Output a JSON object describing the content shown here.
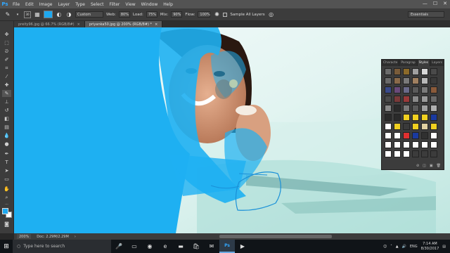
{
  "app": {
    "logo": "Ps"
  },
  "menu": [
    "File",
    "Edit",
    "Image",
    "Layer",
    "Type",
    "Select",
    "Filter",
    "View",
    "Window",
    "Help"
  ],
  "window_controls": [
    "—",
    "☐",
    "✕"
  ],
  "options": {
    "brush_size": "30",
    "mode_value": "Custom",
    "web_label": "Web:",
    "web_value": "80%",
    "load_label": "Load:",
    "load_value": "75%",
    "mix_label": "Mix:",
    "mix_value": "90%",
    "flow_label": "Flow:",
    "flow_value": "100%",
    "sample_all_layers": "Sample All Layers",
    "workspace": "Essentials",
    "brush_color": "#1ea8ef"
  },
  "tabs": [
    {
      "label": "preity96.jpg @ 66.7% (RGB/8#)",
      "close": "×",
      "active": false
    },
    {
      "label": "priyanka50.jpg @ 200% (RGB/8#) *",
      "close": "×",
      "active": true
    }
  ],
  "styles_panel": {
    "tabs": [
      "Characte",
      "Paragrap",
      "Styles",
      "Layers"
    ],
    "active_tab": "Styles",
    "footer_icons": [
      "⊘",
      "◫",
      "▣",
      "🗑"
    ],
    "swatches": [
      "#6b6b6b",
      "#7a5c3a",
      "#8c6a2a",
      "#a0a0a0",
      "#d8d8d8",
      "#4a4a4a",
      "#6a6a6a",
      "#8a6a4a",
      "#7a7a7a",
      "#a08060",
      "#b8b8b8",
      "#3a3a3a",
      "#3a4a8a",
      "#6a4a7a",
      "#6a6a8a",
      "#5a5a5a",
      "#7a7a7a",
      "#8a5a3a",
      "#4a4a4a",
      "#7a3a3a",
      "#9a3a3a",
      "#8a8a8a",
      "#9a9a9a",
      "#6a6a6a",
      "#8a8a8a",
      "#2a2a2a",
      "#7a7a7a",
      "#5a5a5a",
      "#a0a0a0",
      "#b0b0b0",
      "#2a2a2a",
      "#2a2a2a",
      "#f0d020",
      "#f0d020",
      "#f0d020",
      "#1a3aa0",
      "#ffffff",
      "#f0d020",
      "#3a3a3a",
      "#f0d020",
      "#e0d0a0",
      "#f0d020",
      "#ffffff",
      "#ffffff",
      "#e03030",
      "#1a3aa0",
      "#303030",
      "#ffffff",
      "#ffffff",
      "#ffffff",
      "#ffffff",
      "#ffffff",
      "#ffffff",
      "#ffffff",
      "#ffffff",
      "#ffffff",
      "#ffffff",
      "#3c3c3c",
      "#3c3c3c",
      "#3c3c3c"
    ]
  },
  "status": {
    "zoom": "200%",
    "doc": "Doc: 2.29M/2.29M",
    "arrow": "›"
  },
  "taskbar": {
    "search_placeholder": "Type here to search",
    "time": "7:14 AM",
    "date": "8/30/2017",
    "lang": "ENG"
  }
}
